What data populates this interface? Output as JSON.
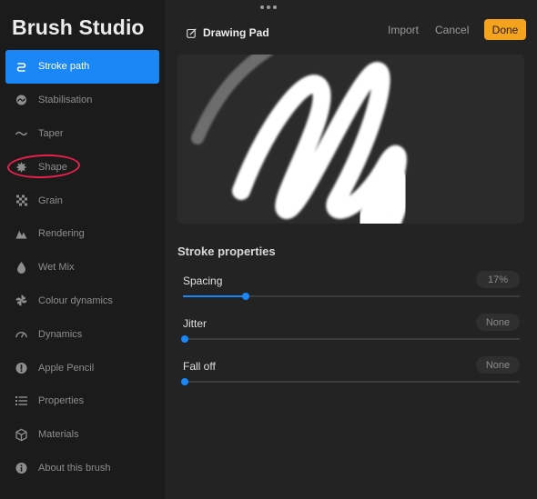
{
  "app": {
    "title": "Brush Studio"
  },
  "sidebar": {
    "items": [
      {
        "label": "Stroke path",
        "icon": "stroke-path-icon",
        "active": true
      },
      {
        "label": "Stabilisation",
        "icon": "stabilisation-icon"
      },
      {
        "label": "Taper",
        "icon": "taper-icon"
      },
      {
        "label": "Shape",
        "icon": "shape-icon"
      },
      {
        "label": "Grain",
        "icon": "grain-icon"
      },
      {
        "label": "Rendering",
        "icon": "rendering-icon"
      },
      {
        "label": "Wet Mix",
        "icon": "wet-mix-icon"
      },
      {
        "label": "Colour dynamics",
        "icon": "colour-dynamics-icon"
      },
      {
        "label": "Dynamics",
        "icon": "dynamics-icon"
      },
      {
        "label": "Apple Pencil",
        "icon": "apple-pencil-icon"
      },
      {
        "label": "Properties",
        "icon": "properties-icon"
      },
      {
        "label": "Materials",
        "icon": "materials-icon"
      },
      {
        "label": "About this brush",
        "icon": "about-icon"
      }
    ],
    "accent": "#1b86f6"
  },
  "header": {
    "doc_title": "Drawing Pad",
    "import_label": "Import",
    "cancel_label": "Cancel",
    "done_label": "Done",
    "done_color": "#f3a31d"
  },
  "stroke_properties": {
    "title": "Stroke properties",
    "props": [
      {
        "name": "Spacing",
        "value": "17%",
        "fraction": 0.18
      },
      {
        "name": "Jitter",
        "value": "None",
        "fraction": 0.0
      },
      {
        "name": "Fall off",
        "value": "None",
        "fraction": 0.0
      }
    ]
  },
  "annotation": {
    "color": "#e8204a",
    "target": "Shape"
  }
}
